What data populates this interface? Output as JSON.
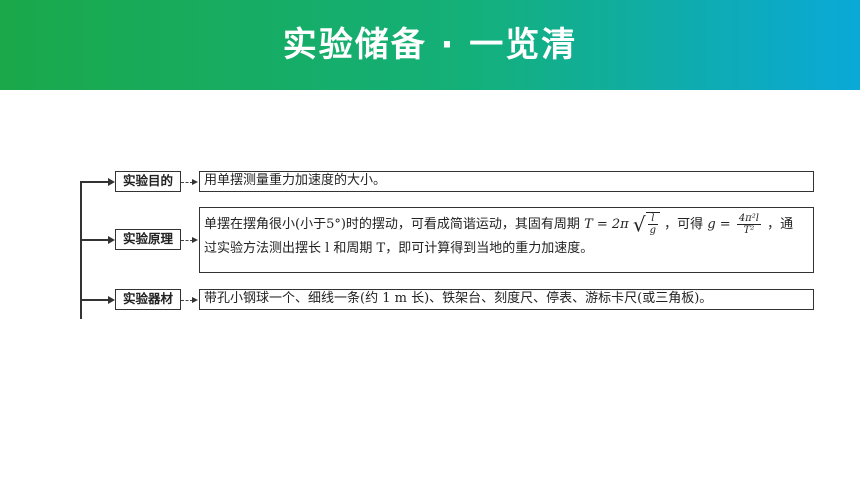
{
  "header": {
    "title": "实验储备 · 一览清",
    "gradient_start": "#1aa84a",
    "gradient_end": "#0aa9d8"
  },
  "rows": [
    {
      "label": "实验目的",
      "text": "用单摆测量重力加速度的大小。"
    },
    {
      "label": "实验原理",
      "text_part1": "单摆在摆角很小(小于5°)时的摆动，可看成简谐运动，其固有周期",
      "period_lhs": "T = 2π",
      "sqrt_num": "l",
      "sqrt_den": "g",
      "text_part2": "，可得",
      "g_lhs": "g =",
      "g_num": "4π²l",
      "g_den": "T²",
      "text_part3": "，通",
      "text_line2": "过实验方法测出摆长 l 和周期 T，即可计算得到当地的重力加速度。"
    },
    {
      "label": "实验器材",
      "text": "带孔小钢球一个、细线一条(约 1 m 长)、铁架台、刻度尺、停表、游标卡尺(或三角板)。"
    }
  ]
}
